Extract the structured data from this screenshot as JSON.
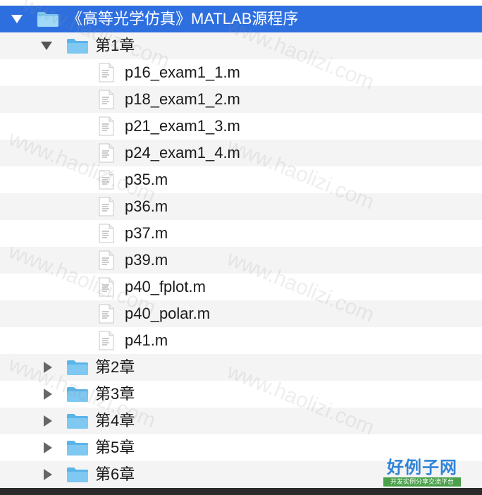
{
  "colors": {
    "selection": "#2e6fe0",
    "folder": "#6bbff0",
    "row_alt": "#f4f4f4"
  },
  "root": {
    "label": "《高等光学仿真》MATLAB源程序",
    "icon": "folder-icon",
    "expanded": true,
    "selected": true
  },
  "chapters": [
    {
      "label": "第1章",
      "expanded": true
    },
    {
      "label": "第2章",
      "expanded": false
    },
    {
      "label": "第3章",
      "expanded": false
    },
    {
      "label": "第4章",
      "expanded": false
    },
    {
      "label": "第5章",
      "expanded": false
    },
    {
      "label": "第6章",
      "expanded": false
    }
  ],
  "chapter1_files": [
    "p16_exam1_1.m",
    "p18_exam1_2.m",
    "p21_exam1_3.m",
    "p24_exam1_4.m",
    "p35.m",
    "p36.m",
    "p37.m",
    "p39.m",
    "p40_fplot.m",
    "p40_polar.m",
    "p41.m"
  ],
  "watermark": "www.haolizi.com",
  "logo": {
    "title": "好例子网",
    "subtitle": "开发实例分享交流平台"
  }
}
